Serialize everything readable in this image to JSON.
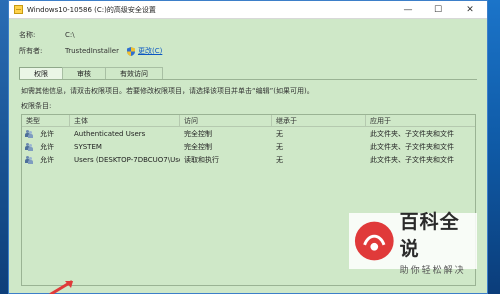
{
  "window": {
    "title": "Windows10-10586 (C:)的高级安全设置",
    "controls": {
      "minimize": "—",
      "maximize": "☐",
      "close": "✕"
    }
  },
  "info": {
    "name_label": "名称:",
    "name_value": "C:\\",
    "owner_label": "所有者:",
    "owner_value": "TrustedInstaller",
    "change_label": "更改(C)",
    "change_icon": "shield-icon"
  },
  "tabs": [
    {
      "label": "权限",
      "active": true
    },
    {
      "label": "审核",
      "active": false
    },
    {
      "label": "有效访问",
      "active": false
    }
  ],
  "hint_text": "如需其他信息，请双击权限项目。若要修改权限项目，请选择该项目并单击“编辑”(如果可用)。",
  "list_label": "权限条目:",
  "table": {
    "headers": {
      "type": "类型",
      "subject": "主体",
      "access": "访问",
      "inherit": "继承于",
      "apply": "应用于"
    },
    "rows": [
      {
        "type": "允许",
        "subject": "Authenticated Users",
        "access": "完全控制",
        "inherit": "无",
        "apply": "此文件夹、子文件夹和文件"
      },
      {
        "type": "允许",
        "subject": "SYSTEM",
        "access": "完全控制",
        "inherit": "无",
        "apply": "此文件夹、子文件夹和文件"
      },
      {
        "type": "允许",
        "subject": "Users (DESKTOP-7DBCUO7\\User...",
        "access": "读取和执行",
        "inherit": "无",
        "apply": "此文件夹、子文件夹和文件"
      }
    ]
  },
  "watermark": {
    "main": "百科全说",
    "sub": "助你轻松解决"
  },
  "colors": {
    "window_bg": "#cfe8c8",
    "link": "#0b57c2",
    "accent": "#e03a3a"
  }
}
